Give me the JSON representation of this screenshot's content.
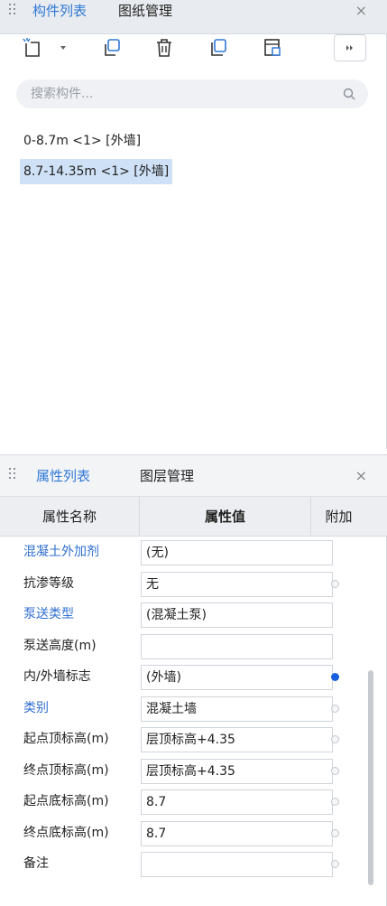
{
  "top_panel": {
    "tabs": [
      {
        "label": "构件列表",
        "active": true
      },
      {
        "label": "图纸管理",
        "active": false
      }
    ],
    "close_glyph": "×",
    "toolbar": {
      "icons": [
        "new-component-icon",
        "dropdown-arrow-icon",
        "copy-icon",
        "delete-icon",
        "copy-to-floor-icon",
        "floor-copy-icon",
        "more-icon"
      ]
    },
    "search": {
      "placeholder": "搜索构件...",
      "value": ""
    },
    "components": [
      {
        "label": "0-8.7m <1> [外墙]",
        "selected": false
      },
      {
        "label": "8.7-14.35m <1> [外墙]",
        "selected": true
      }
    ]
  },
  "bottom_panel": {
    "tabs": [
      {
        "label": "属性列表",
        "active": true
      },
      {
        "label": "图层管理",
        "active": false
      }
    ],
    "close_glyph": "×",
    "columns": {
      "name": "属性名称",
      "value": "属性值",
      "extra": "附加"
    },
    "properties": [
      {
        "name": "混凝土外加剂",
        "value": "(无)",
        "name_color": "blue",
        "attach": "none"
      },
      {
        "name": "抗渗等级",
        "value": "无",
        "name_color": "black",
        "attach": "unchecked"
      },
      {
        "name": "泵送类型",
        "value": "(混凝土泵)",
        "name_color": "blue",
        "attach": "none"
      },
      {
        "name": "泵送高度(m)",
        "value": "",
        "name_color": "black",
        "attach": "none"
      },
      {
        "name": "内/外墙标志",
        "value": "(外墙)",
        "name_color": "black",
        "attach": "checked"
      },
      {
        "name": "类别",
        "value": "混凝土墙",
        "name_color": "blue",
        "attach": "unchecked"
      },
      {
        "name": "起点顶标高(m)",
        "value": "层顶标高+4.35",
        "name_color": "black",
        "attach": "unchecked"
      },
      {
        "name": "终点顶标高(m)",
        "value": "层顶标高+4.35",
        "name_color": "black",
        "attach": "unchecked"
      },
      {
        "name": "起点底标高(m)",
        "value": "8.7",
        "name_color": "black",
        "attach": "unchecked"
      },
      {
        "name": "终点底标高(m)",
        "value": "8.7",
        "name_color": "black",
        "attach": "unchecked"
      },
      {
        "name": "备注",
        "value": "",
        "name_color": "black",
        "attach": "unchecked"
      }
    ]
  },
  "colors": {
    "accent": "#2f78d6",
    "property_link": "#2f6fd0",
    "selection": "#cfe1f6",
    "checked_dot": "#1a5fe0"
  }
}
